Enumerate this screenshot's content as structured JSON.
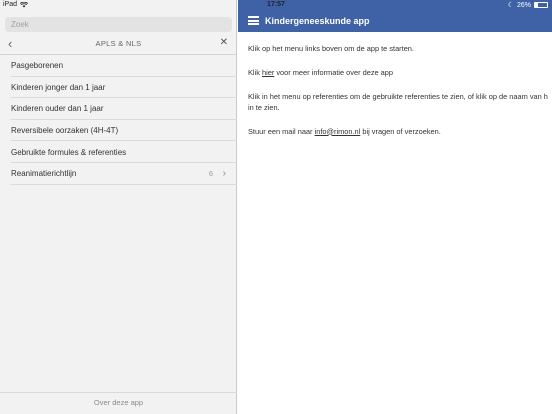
{
  "status_bar": {
    "device": "iPad",
    "time": "17:57",
    "battery": "26%",
    "battery_level": 0.26,
    "moon_icon": "moon-icon"
  },
  "sidebar": {
    "search_placeholder": "Zoek",
    "nav_title": "APLS & NLS",
    "items": [
      {
        "label": "Pasgeborenen"
      },
      {
        "label": "Kinderen jonger dan 1 jaar"
      },
      {
        "label": "Kinderen ouder dan 1 jaar"
      },
      {
        "label": "Reversibele oorzaken (4H-4T)"
      },
      {
        "label": "Gebruikte formules & referenties"
      },
      {
        "label": "Reanimatierichtlijn",
        "count": "6"
      }
    ],
    "footer": "Over deze app"
  },
  "header": {
    "title": "Kindergeneeskunde app",
    "color": "#3f62a7"
  },
  "content": {
    "p1": "Klik op het menu links boven om de app te starten.",
    "p2_before": "Klik ",
    "p2_link": "hier",
    "p2_after": " voor meer informatie over deze app",
    "p3": "Klik in het menu op referenties om de gebruikte referenties te zien, of klik op de naam van het onderwerp om de bijbehorende referenties te zien.",
    "p3_line1": "Klik in het menu op referenties om de gebruikte referenties te zien, of klik op de naam van h",
    "p3_line2": "in te zien.",
    "p4_before": "Stuur een mail naar ",
    "p4_link": "info@rimon.nl",
    "p4_after": " bij vragen of verzoeken."
  }
}
